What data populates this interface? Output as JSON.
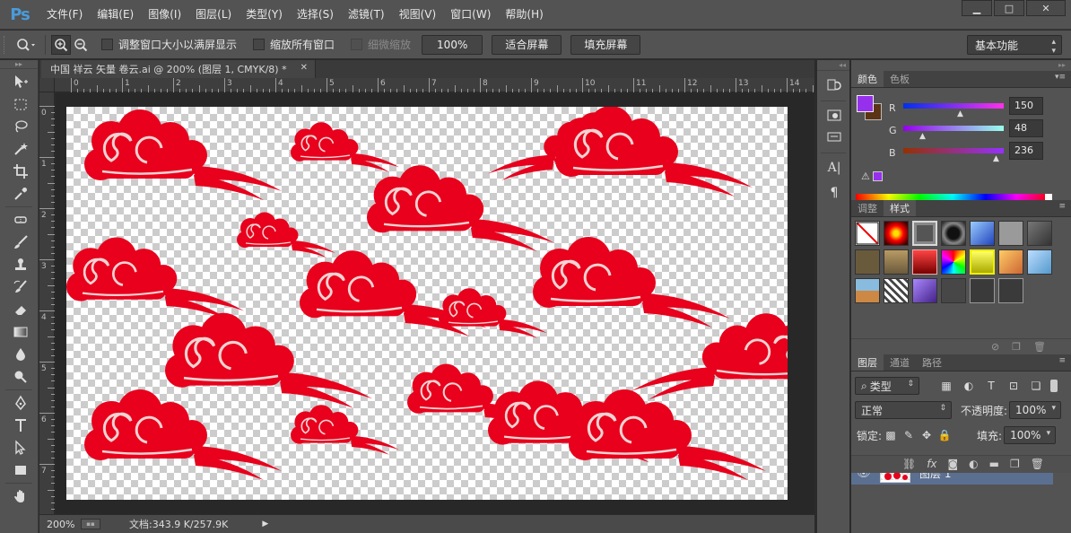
{
  "app": {
    "logo": "Ps"
  },
  "menu": [
    "文件(F)",
    "编辑(E)",
    "图像(I)",
    "图层(L)",
    "类型(Y)",
    "选择(S)",
    "滤镜(T)",
    "视图(V)",
    "窗口(W)",
    "帮助(H)"
  ],
  "window_controls": {
    "minimize": "▁",
    "maximize": "□",
    "close": "✕"
  },
  "options": {
    "resize_windows": "调整窗口大小以满屏显示",
    "zoom_all": "缩放所有窗口",
    "scrubby_zoom": "细微缩放",
    "zoom_100": "100%",
    "fit_screen": "适合屏幕",
    "fill_screen": "填充屏幕",
    "workspace": "基本功能"
  },
  "document": {
    "tab_title": "中国 祥云 矢量 卷云.ai @ 200% (图层 1, CMYK/8) *",
    "zoom": "200%",
    "doc_size": "文档:343.9 K/257.9K"
  },
  "rulers": {
    "h": [
      "0",
      "1",
      "2",
      "3",
      "4",
      "5",
      "6",
      "7",
      "8",
      "9",
      "10",
      "11",
      "12",
      "13",
      "14"
    ],
    "v": [
      "0",
      "1",
      "2",
      "3",
      "4",
      "5",
      "6",
      "7"
    ]
  },
  "color_panel": {
    "tabs": [
      "颜色",
      "色板"
    ],
    "fg_color": "#9630ec",
    "bg_color": "#5a3414",
    "r_label": "R",
    "g_label": "G",
    "b_label": "B",
    "r": "150",
    "g": "48",
    "b": "236"
  },
  "styles_panel": {
    "tabs": [
      "调整",
      "样式"
    ]
  },
  "layers_panel": {
    "tabs": [
      "图层",
      "通道",
      "路径"
    ],
    "filter": "类型",
    "blend_mode": "正常",
    "opacity_label": "不透明度:",
    "opacity": "100%",
    "lock_label": "锁定:",
    "fill_label": "填充:",
    "fill": "100%",
    "layer_name": "图层 1"
  },
  "cloud_color": "#e8001c"
}
